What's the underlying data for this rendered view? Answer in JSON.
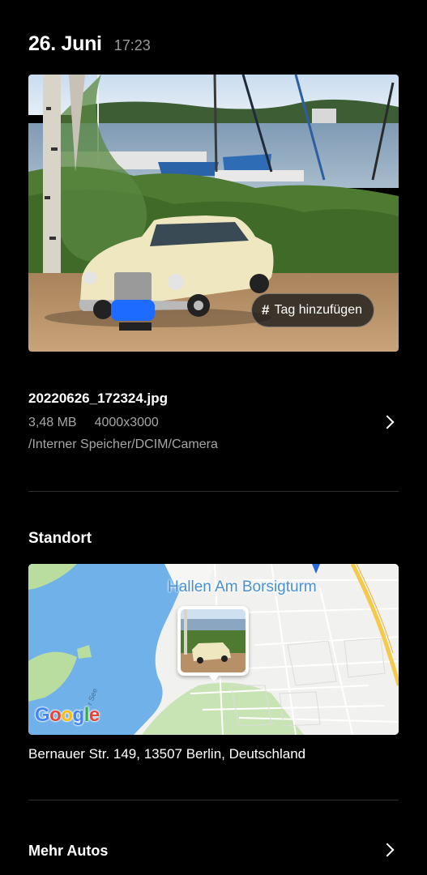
{
  "header": {
    "date": "26. Juni",
    "time": "17:23"
  },
  "photo": {
    "tag_button_label": "Tag hinzufügen"
  },
  "file": {
    "name": "20220626_172324.jpg",
    "size": "3,48 MB",
    "resolution": "4000x3000",
    "path": "/Interner Speicher/DCIM/Camera"
  },
  "location": {
    "section_title": "Standort",
    "map_place_label": "Hallen Am Borsigturm",
    "map_water_label": "r See",
    "map_brand": "Google",
    "address": "Bernauer Str. 149, 13507 Berlin, Deutschland"
  },
  "more": {
    "label": "Mehr Autos"
  },
  "colors": {
    "background": "#000000",
    "secondary_text": "#a6a6a6",
    "map_label": "#4a90d0",
    "water": "#6fb1e8"
  }
}
